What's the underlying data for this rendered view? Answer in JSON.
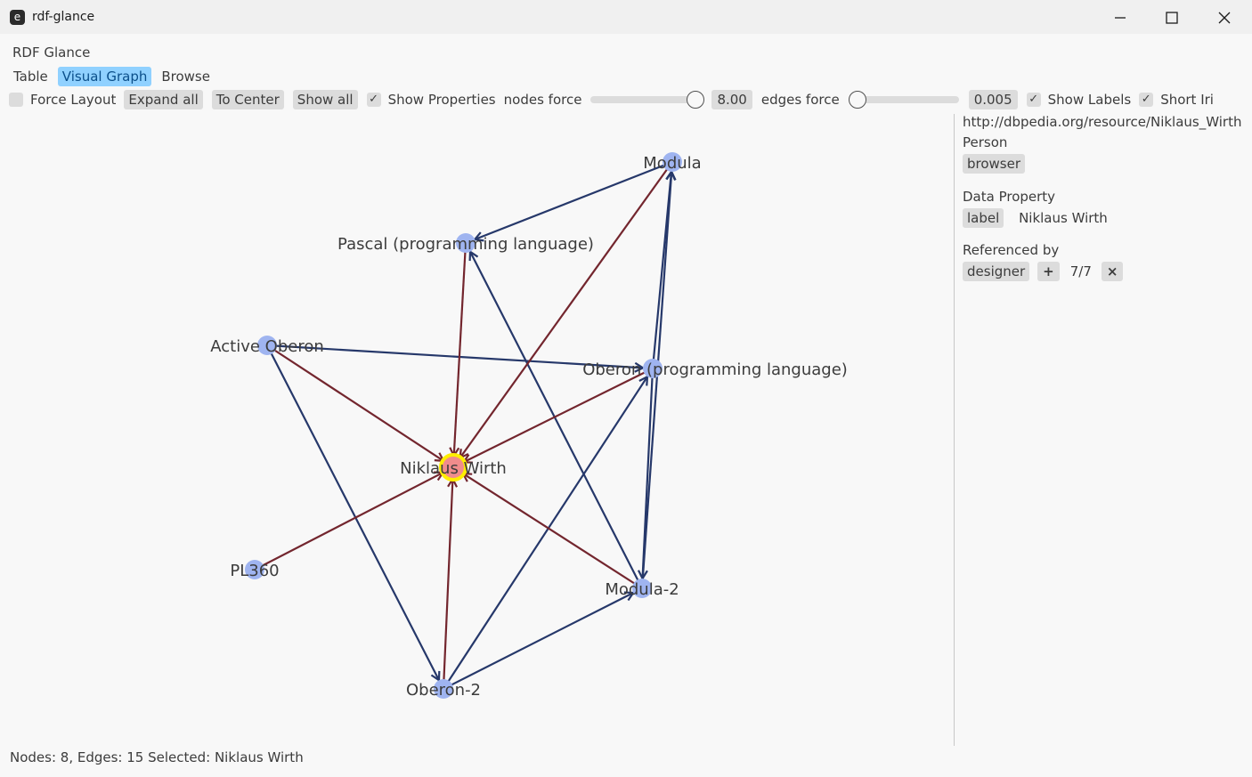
{
  "window": {
    "title": "rdf-glance",
    "icon": "e"
  },
  "app": {
    "name": "RDF Glance"
  },
  "tabs": [
    {
      "label": "Table",
      "active": false
    },
    {
      "label": "Visual Graph",
      "active": true
    },
    {
      "label": "Browse",
      "active": false
    }
  ],
  "toolbar": {
    "force_layout": {
      "label": "Force Layout",
      "checked": false
    },
    "expand_all": "Expand all",
    "to_center": "To Center",
    "show_all": "Show all",
    "show_properties": {
      "label": "Show Properties",
      "checked": true
    },
    "nodes_force": {
      "label": "nodes force",
      "value": "8.00",
      "fraction": 1.0
    },
    "edges_force": {
      "label": "edges force",
      "value": "0.005",
      "fraction": 0.0
    },
    "show_labels": {
      "label": "Show Labels",
      "checked": true
    },
    "short_iri": {
      "label": "Short Iri",
      "checked": true
    }
  },
  "colors": {
    "node": "#9fb4f0",
    "selected_node": "#f08c8c",
    "selected_ring": "#ffee00",
    "edge_out": "#26386a",
    "edge_in": "#73262e",
    "active_tab": "#90d1ff"
  },
  "graph": {
    "selected": "Niklaus Wirth",
    "nodes": [
      {
        "id": "modula",
        "label": "Modula"
      },
      {
        "id": "pascal",
        "label": "Pascal (programming language)"
      },
      {
        "id": "active_oberon",
        "label": "Active Oberon"
      },
      {
        "id": "oberon",
        "label": "Oberon (programming language)"
      },
      {
        "id": "wirth",
        "label": "Niklaus Wirth",
        "selected": true
      },
      {
        "id": "pl360",
        "label": "PL360"
      },
      {
        "id": "modula2",
        "label": "Modula-2"
      },
      {
        "id": "oberon2",
        "label": "Oberon-2"
      }
    ],
    "edges": [
      {
        "from": "modula",
        "to": "pascal",
        "kind": "out"
      },
      {
        "from": "oberon",
        "to": "modula",
        "kind": "out"
      },
      {
        "from": "modula2",
        "to": "modula",
        "kind": "out"
      },
      {
        "from": "modula2",
        "to": "pascal",
        "kind": "out"
      },
      {
        "from": "active_oberon",
        "to": "oberon",
        "kind": "out"
      },
      {
        "from": "active_oberon",
        "to": "oberon2",
        "kind": "out"
      },
      {
        "from": "oberon",
        "to": "modula2",
        "kind": "out"
      },
      {
        "from": "oberon2",
        "to": "oberon",
        "kind": "out"
      },
      {
        "from": "oberon2",
        "to": "modula2",
        "kind": "out"
      },
      {
        "from": "pascal",
        "to": "wirth",
        "kind": "in"
      },
      {
        "from": "modula",
        "to": "wirth",
        "kind": "in"
      },
      {
        "from": "active_oberon",
        "to": "wirth",
        "kind": "in"
      },
      {
        "from": "oberon",
        "to": "wirth",
        "kind": "in"
      },
      {
        "from": "pl360",
        "to": "wirth",
        "kind": "in"
      },
      {
        "from": "modula2",
        "to": "wirth",
        "kind": "in"
      },
      {
        "from": "oberon2",
        "to": "wirth",
        "kind": "in"
      }
    ]
  },
  "details": {
    "iri": "http://dbpedia.org/resource/Niklaus_Wirth",
    "type": "Person",
    "type_tag": "browser",
    "data_property_heading": "Data Property",
    "data_properties": [
      {
        "key": "label",
        "value": "Niklaus Wirth"
      }
    ],
    "referenced_by_heading": "Referenced by",
    "references": [
      {
        "predicate": "designer",
        "expand": "+",
        "count": "7/7",
        "remove": "×"
      }
    ]
  },
  "status": {
    "text": "Nodes: 8, Edges: 15 Selected: Niklaus Wirth"
  }
}
